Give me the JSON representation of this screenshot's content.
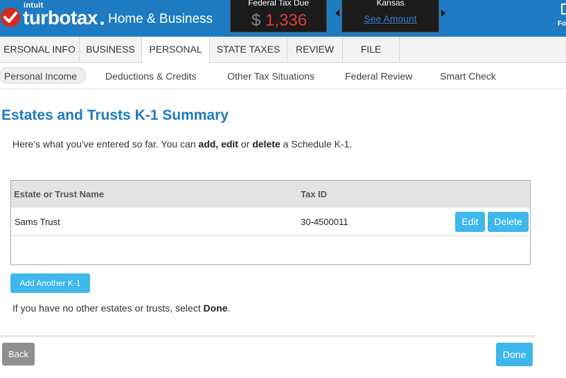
{
  "header": {
    "brand_intuit": "intuit",
    "brand_name": "turbotax",
    "edition": "Home & Business",
    "federal": {
      "label": "Federal Tax Due",
      "currency": "$",
      "amount": "1,336"
    },
    "state": {
      "label": "Kansas",
      "link": "See Amount"
    },
    "right_text": "Fo",
    "icons": [
      "checkmark-logo-icon",
      "arrow-left-icon",
      "arrow-right-icon",
      "document-icon"
    ],
    "colors": {
      "brand_blue": "#1f7bc1",
      "amount_red": "#e23b3b",
      "link_blue": "#3a78c9"
    }
  },
  "tabs": [
    {
      "label": "ERSONAL INFO"
    },
    {
      "label": "BUSINESS"
    },
    {
      "label": "PERSONAL"
    },
    {
      "label": "STATE TAXES"
    },
    {
      "label": "REVIEW"
    },
    {
      "label": "FILE"
    }
  ],
  "active_tab": "PERSONAL",
  "subnav": [
    {
      "label": "Personal Income"
    },
    {
      "label": "Deductions & Credits"
    },
    {
      "label": "Other Tax Situations"
    },
    {
      "label": "Federal Review"
    },
    {
      "label": "Smart Check"
    }
  ],
  "active_subnav": "Personal Income",
  "main": {
    "title": "Estates and Trusts K-1 Summary",
    "intro": {
      "part1": "Here's what you've entered so far. You can ",
      "add": "add,",
      "sep1": " ",
      "edit": "edit",
      "sep2": " or ",
      "delete": "delete",
      "part2": " a Schedule K-1."
    },
    "table": {
      "columns": [
        "Estate or Trust Name",
        "Tax ID"
      ],
      "rows": [
        {
          "name": "Sams Trust",
          "tax_id": "30-4500011"
        }
      ],
      "edit_label": "Edit",
      "delete_label": "Delete"
    },
    "add_button": "Add Another K-1",
    "outro": {
      "part1": "If you have no other estates or trusts, select ",
      "done": "Done",
      "part2": "."
    }
  },
  "footer": {
    "back": "Back",
    "done": "Done",
    "colors": {
      "button_blue": "#3db7ec",
      "back_gray": "#8f8f8f"
    }
  }
}
